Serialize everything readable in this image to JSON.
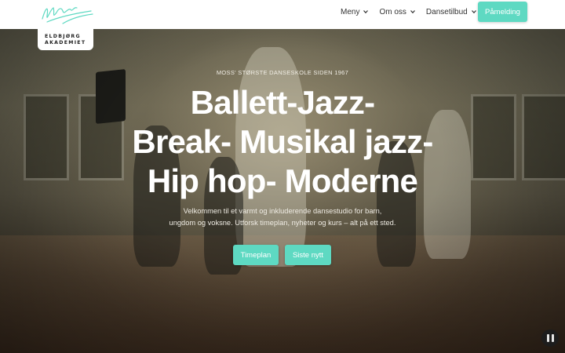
{
  "header": {
    "logo_lines": [
      "ELDBJØRG",
      "AKADEMIET"
    ],
    "nav": [
      {
        "label": "Meny",
        "icon": "chevron-down-icon"
      },
      {
        "label": "Om oss",
        "icon": "chevron-down-icon"
      },
      {
        "label": "Dansetilbud",
        "icon": "chevron-down-icon"
      }
    ],
    "cta_label": "Påmelding"
  },
  "hero": {
    "eyebrow": "MOSS' STØRSTE DANSESKOLE SIDEN 1967",
    "headline_lines": [
      "Ballett-Jazz-",
      "Break- Musikal jazz-",
      "Hip hop- Moderne"
    ],
    "intro_lines": [
      "Velkommen til et varmt og inkluderende dansestudio for barn,",
      "ungdom og voksne. Utforsk timeplan, nyheter og kurs – alt på ett sted."
    ],
    "buttons": [
      {
        "label": "Timeplan"
      },
      {
        "label": "Siste nytt"
      }
    ]
  },
  "video_control": {
    "icon": "pause-icon"
  },
  "colors": {
    "accent": "#5ed9c2",
    "header_bg": "#ffffff"
  }
}
